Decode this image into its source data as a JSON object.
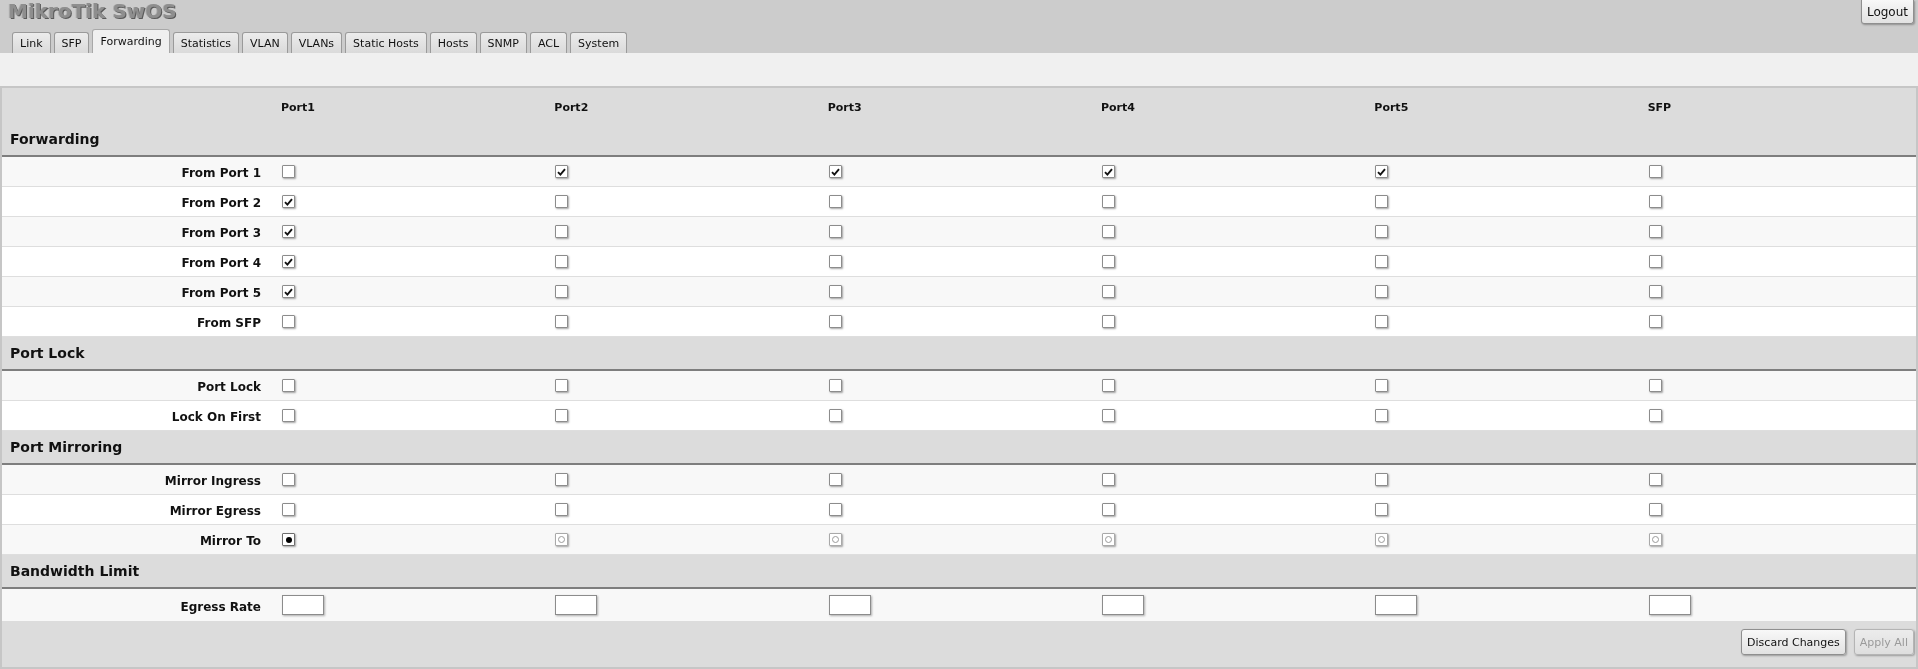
{
  "header": {
    "title": "MikroTik SwOS",
    "logout": "Logout"
  },
  "tabs": [
    {
      "label": "Link",
      "selected": false
    },
    {
      "label": "SFP",
      "selected": false
    },
    {
      "label": "Forwarding",
      "selected": true
    },
    {
      "label": "Statistics",
      "selected": false
    },
    {
      "label": "VLAN",
      "selected": false
    },
    {
      "label": "VLANs",
      "selected": false
    },
    {
      "label": "Static Hosts",
      "selected": false
    },
    {
      "label": "Hosts",
      "selected": false
    },
    {
      "label": "SNMP",
      "selected": false
    },
    {
      "label": "ACL",
      "selected": false
    },
    {
      "label": "System",
      "selected": false
    }
  ],
  "table": {
    "columns": [
      "Port1",
      "Port2",
      "Port3",
      "Port4",
      "Port5",
      "SFP"
    ],
    "sections": [
      {
        "title": "Forwarding",
        "rows": [
          {
            "label": "From Port 1",
            "kind": "checkbox",
            "cells": [
              {
                "checked": false
              },
              {
                "checked": true
              },
              {
                "checked": true
              },
              {
                "checked": true
              },
              {
                "checked": true
              },
              {
                "checked": false
              }
            ]
          },
          {
            "label": "From Port 2",
            "kind": "checkbox",
            "cells": [
              {
                "checked": true
              },
              {
                "checked": false
              },
              {
                "checked": false
              },
              {
                "checked": false
              },
              {
                "checked": false
              },
              {
                "checked": false
              }
            ]
          },
          {
            "label": "From Port 3",
            "kind": "checkbox",
            "cells": [
              {
                "checked": true
              },
              {
                "checked": false
              },
              {
                "checked": false
              },
              {
                "checked": false
              },
              {
                "checked": false
              },
              {
                "checked": false
              }
            ]
          },
          {
            "label": "From Port 4",
            "kind": "checkbox",
            "cells": [
              {
                "checked": true
              },
              {
                "checked": false
              },
              {
                "checked": false
              },
              {
                "checked": false
              },
              {
                "checked": false
              },
              {
                "checked": false
              }
            ]
          },
          {
            "label": "From Port 5",
            "kind": "checkbox",
            "cells": [
              {
                "checked": true
              },
              {
                "checked": false
              },
              {
                "checked": false
              },
              {
                "checked": false
              },
              {
                "checked": false
              },
              {
                "checked": false
              }
            ]
          },
          {
            "label": "From SFP",
            "kind": "checkbox",
            "cells": [
              {
                "checked": false
              },
              {
                "checked": false
              },
              {
                "checked": false
              },
              {
                "checked": false
              },
              {
                "checked": false
              },
              {
                "checked": false
              }
            ]
          }
        ]
      },
      {
        "title": "Port Lock",
        "rows": [
          {
            "label": "Port Lock",
            "kind": "checkbox",
            "cells": [
              {
                "checked": false
              },
              {
                "checked": false
              },
              {
                "checked": false
              },
              {
                "checked": false
              },
              {
                "checked": false
              },
              {
                "checked": false
              }
            ]
          },
          {
            "label": "Lock On First",
            "kind": "checkbox",
            "cells": [
              {
                "checked": false
              },
              {
                "checked": false
              },
              {
                "checked": false
              },
              {
                "checked": false
              },
              {
                "checked": false
              },
              {
                "checked": false
              }
            ]
          }
        ]
      },
      {
        "title": "Port Mirroring",
        "rows": [
          {
            "label": "Mirror Ingress",
            "kind": "checkbox",
            "cells": [
              {
                "checked": false
              },
              {
                "checked": false
              },
              {
                "checked": false
              },
              {
                "checked": false
              },
              {
                "checked": false
              },
              {
                "checked": false
              }
            ]
          },
          {
            "label": "Mirror Egress",
            "kind": "checkbox",
            "cells": [
              {
                "checked": false
              },
              {
                "checked": false
              },
              {
                "checked": false
              },
              {
                "checked": false
              },
              {
                "checked": false
              },
              {
                "checked": false
              }
            ]
          },
          {
            "label": "Mirror To",
            "kind": "radio",
            "cells": [
              {
                "selected": true
              },
              {
                "selected": false
              },
              {
                "selected": false
              },
              {
                "selected": false
              },
              {
                "selected": false
              },
              {
                "selected": false
              }
            ]
          }
        ]
      },
      {
        "title": "Bandwidth Limit",
        "rows": [
          {
            "label": "Egress Rate",
            "kind": "input"
          }
        ]
      }
    ]
  },
  "footer": {
    "buttons": [
      {
        "label": "Discard Changes",
        "disabled": false
      },
      {
        "label": "Apply All",
        "disabled": true
      }
    ]
  }
}
